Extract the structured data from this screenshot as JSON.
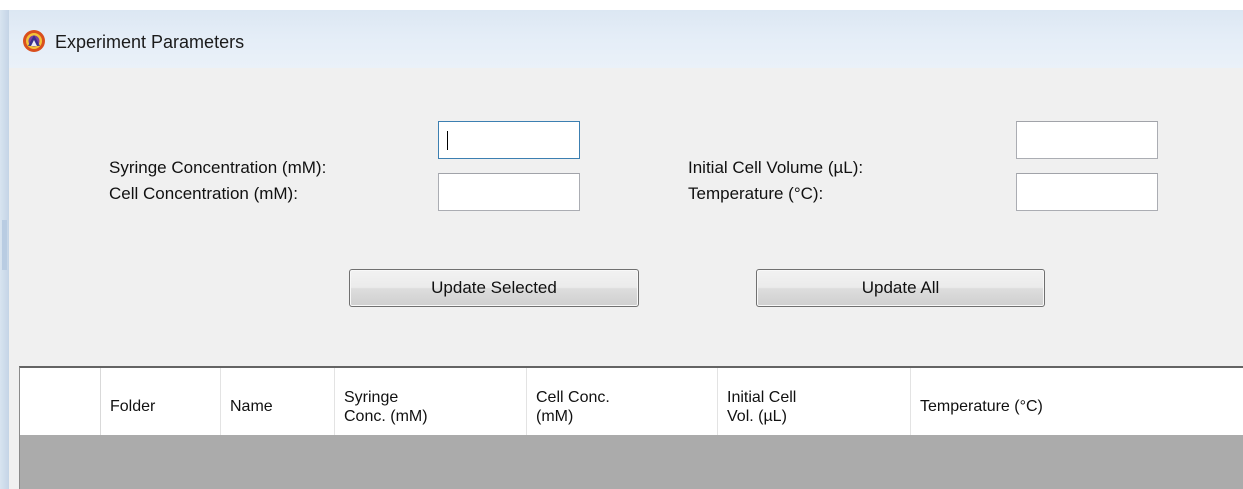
{
  "window": {
    "title": "Experiment Parameters",
    "icon": "app-logo-icon"
  },
  "form": {
    "syringe_concentration": {
      "label": "Syringe Concentration  (mM):",
      "value": ""
    },
    "cell_concentration": {
      "label": "Cell Concentration  (mM):",
      "value": ""
    },
    "initial_cell_volume": {
      "label": "Initial Cell Volume (µL):",
      "value": ""
    },
    "temperature": {
      "label": "Temperature (°C):",
      "value": ""
    }
  },
  "buttons": {
    "update_selected": "Update Selected",
    "update_all": "Update All"
  },
  "grid": {
    "columns": [
      "Folder",
      "Name",
      "Syringe\nConc. (mM)",
      "Cell Conc.\n(mM)",
      "Initial Cell\nVol. (µL)",
      "Temperature (°C)"
    ],
    "rows": []
  },
  "colors": {
    "titlebar": "#dce7f3",
    "window_bg": "#f0f0f0",
    "grid_empty_bg": "#ababab"
  }
}
